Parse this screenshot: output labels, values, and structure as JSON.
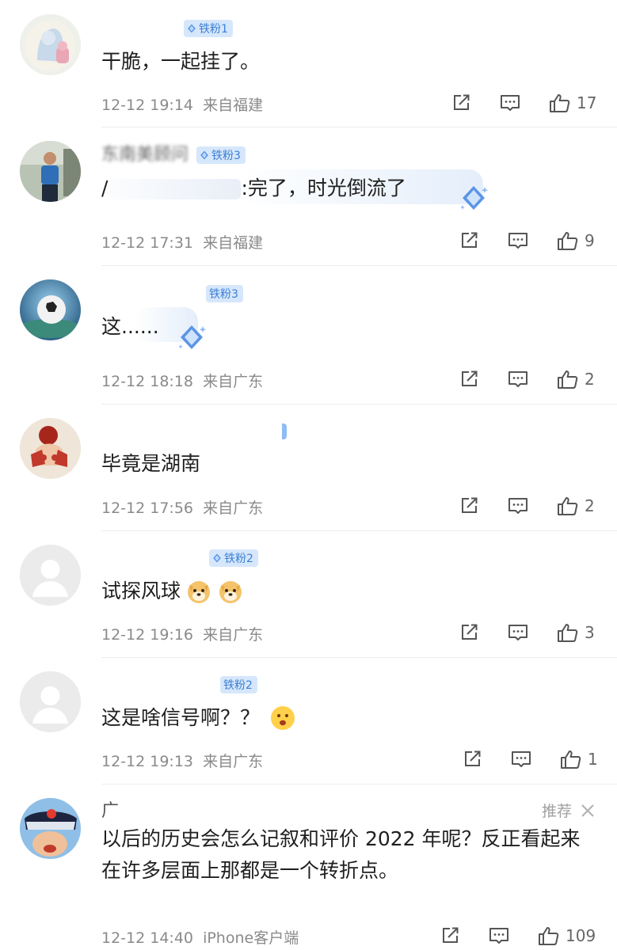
{
  "comments": [
    {
      "name": "",
      "badge": "铁粉1",
      "content": "干脆，一起挂了。",
      "time": "12-12 19:14",
      "location": "来自福建",
      "likes": "17"
    },
    {
      "name": "东南美顾问",
      "badge": "铁粉3",
      "content_prefix": "/",
      "content": ":完了，时光倒流了",
      "time": "12-12 17:31",
      "location": "来自福建",
      "likes": "9"
    },
    {
      "name": "",
      "badge": "铁粉3",
      "content": "这......",
      "time": "12-12 18:18",
      "location": "来自广东",
      "likes": "2"
    },
    {
      "name": "",
      "badge": "",
      "content": "毕竟是湖南",
      "time": "12-12 17:56",
      "location": "来自广东",
      "likes": "2"
    },
    {
      "name": "",
      "badge": "铁粉2",
      "content": "试探风球",
      "time": "12-12 19:16",
      "location": "来自广东",
      "likes": "3"
    },
    {
      "name": "",
      "badge": "铁粉2",
      "content": "这是啥信号啊？？",
      "time": "12-12 19:13",
      "location": "来自广东",
      "likes": "1"
    },
    {
      "name": "广",
      "badge": "",
      "recommend": "推荐",
      "content": "以后的历史会怎么记叙和评价 2022 年呢？反正看起来在许多层面上那都是一个转折点。",
      "time": "12-12 14:40",
      "location": "iPhone客户端",
      "likes": "109"
    }
  ],
  "colors": {
    "badge_bg": "#d6e7fb",
    "badge_text": "#3c7fd6",
    "meta_text": "#8a8a8a",
    "icon_stroke": "#555555"
  },
  "icons": [
    "share-icon",
    "comment-icon",
    "thumbs-up-icon",
    "close-icon",
    "diamond-gem-icon",
    "doge-emoji-icon",
    "frown-emoji-icon"
  ]
}
